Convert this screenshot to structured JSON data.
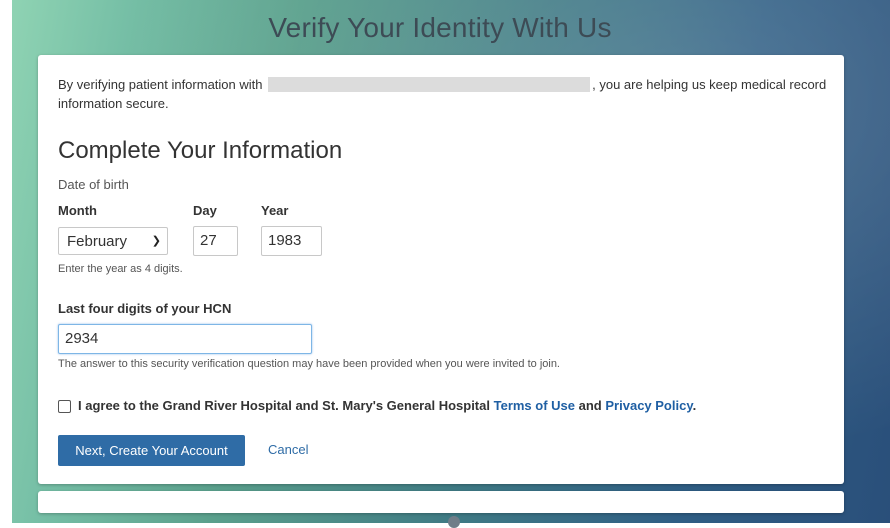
{
  "page": {
    "title": "Verify Your Identity With Us"
  },
  "intro": {
    "before": "By verifying patient information with",
    "after": ", you are helping us keep medical record information secure."
  },
  "form": {
    "section_title": "Complete Your Information",
    "dob_label": "Date of birth",
    "month_label": "Month",
    "day_label": "Day",
    "year_label": "Year",
    "month_value": "February",
    "day_value": "27",
    "year_value": "1983",
    "year_hint": "Enter the year as 4 digits.",
    "hcn_label": "Last four digits of your HCN",
    "hcn_value": "2934",
    "hcn_hint": "The answer to this security verification question may have been provided when you were invited to join.",
    "agree_text": "I agree to the Grand River Hospital and St. Mary's General Hospital",
    "terms_link": "Terms of Use",
    "and_text": "and",
    "privacy_link": "Privacy Policy",
    "period": ".",
    "agree_checked": false
  },
  "actions": {
    "next_label": "Next, Create Your Account",
    "cancel_label": "Cancel"
  },
  "colors": {
    "primary": "#2f6ca6",
    "link": "#1f5fa3"
  },
  "icons": {
    "select_chevron": "chevron-down-icon"
  }
}
